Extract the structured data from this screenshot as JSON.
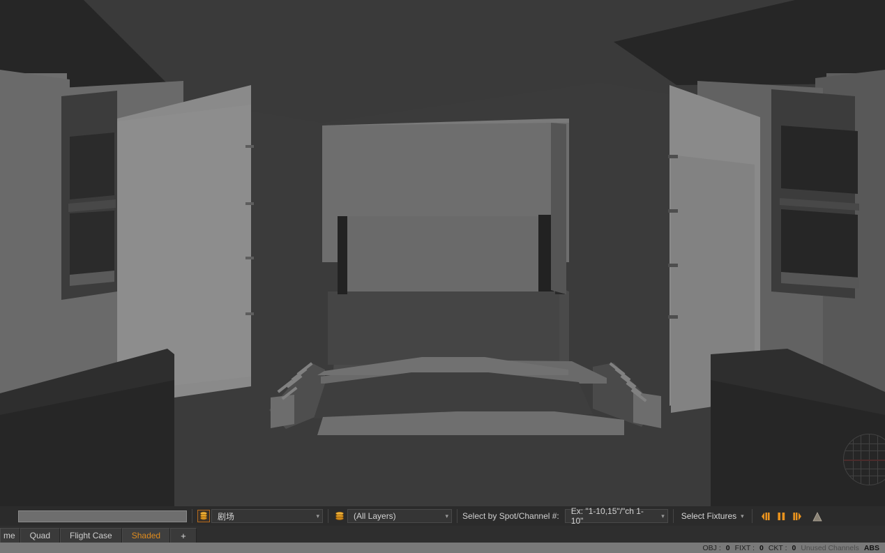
{
  "viewport": {
    "name": "shaded-3d-theater-render",
    "scene_description": "Shaded 3D render of a theater auditorium interior viewed from the rear house, showing the proscenium arch, stage, orchestra pit with side stairs, and side-wall balcony boxes.",
    "gizmo_name": "view-navigation-sphere"
  },
  "toolbar": {
    "search": {
      "value": "",
      "placeholder": ""
    },
    "active_layer": {
      "icon": "layer-stack-icon",
      "value": "剧场"
    },
    "layers_filter": {
      "icon": "layers-icon",
      "value": "(All Layers)"
    },
    "select_by_label": "Select by Spot/Channel #:",
    "spot_channel": {
      "value": "Ex: \"1-10,15\"/\"ch 1-10\""
    },
    "select_fixtures": {
      "label": "Select Fixtures"
    },
    "fixture_buttons": [
      {
        "name": "select-previous-fixture-button",
        "icon": "previous-fixture-icon"
      },
      {
        "name": "select-all-fixtures-button",
        "icon": "all-fixtures-icon"
      },
      {
        "name": "select-next-fixture-button",
        "icon": "next-fixture-icon"
      }
    ],
    "beam_button": {
      "name": "light-beam-button",
      "icon": "beam-cone-icon"
    },
    "caret_glyph": "▾"
  },
  "tabs": {
    "items": [
      {
        "label": "me",
        "active": false,
        "clipped": true
      },
      {
        "label": "Quad",
        "active": false,
        "clipped": false
      },
      {
        "label": "Flight Case",
        "active": false,
        "clipped": false
      },
      {
        "label": "Shaded",
        "active": true,
        "clipped": false
      }
    ],
    "add_label": "+"
  },
  "statusbar": {
    "obj_label": "OBJ :",
    "obj_value": "0",
    "fixt_label": "FIXT :",
    "fixt_value": "0",
    "ckt_label": "CKT :",
    "ckt_value": "0",
    "unused_channels": "Unused Channels",
    "mode": "ABS"
  },
  "colors": {
    "accent_orange": "#e08c1e",
    "toolbar_bg": "#2b2b2b",
    "viewport_bg": "#3b3b3b",
    "statusbar_bg": "#797979"
  }
}
